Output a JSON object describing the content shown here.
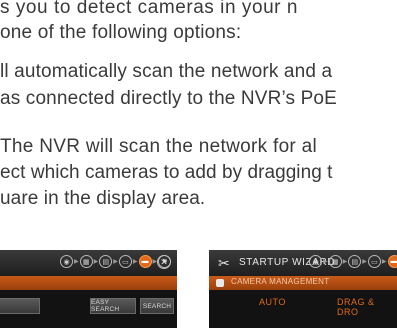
{
  "paragraphs": {
    "line1": "s you to detect cameras in your n",
    "line2": "one of the following options:",
    "line3": "ll automatically scan the network and a",
    "line4": "as connected directly to the NVR’s PoE",
    "line5": "The NVR will scan the network for al",
    "line6": "ect which cameras to add by dragging t",
    "line7": "uare in the display area."
  },
  "left_panel": {
    "buttons": [
      "EASY SEARCH",
      "SEARCH"
    ]
  },
  "right_panel": {
    "title": "STARTUP WIZARD",
    "section": "CAMERA MANAGEMENT",
    "mode_auto": "AUTO",
    "mode_drag": "DRAG & DRO"
  },
  "colors": {
    "accent": "#e0691c",
    "panel_bg": "#121212",
    "text": "#3a3a3a"
  }
}
